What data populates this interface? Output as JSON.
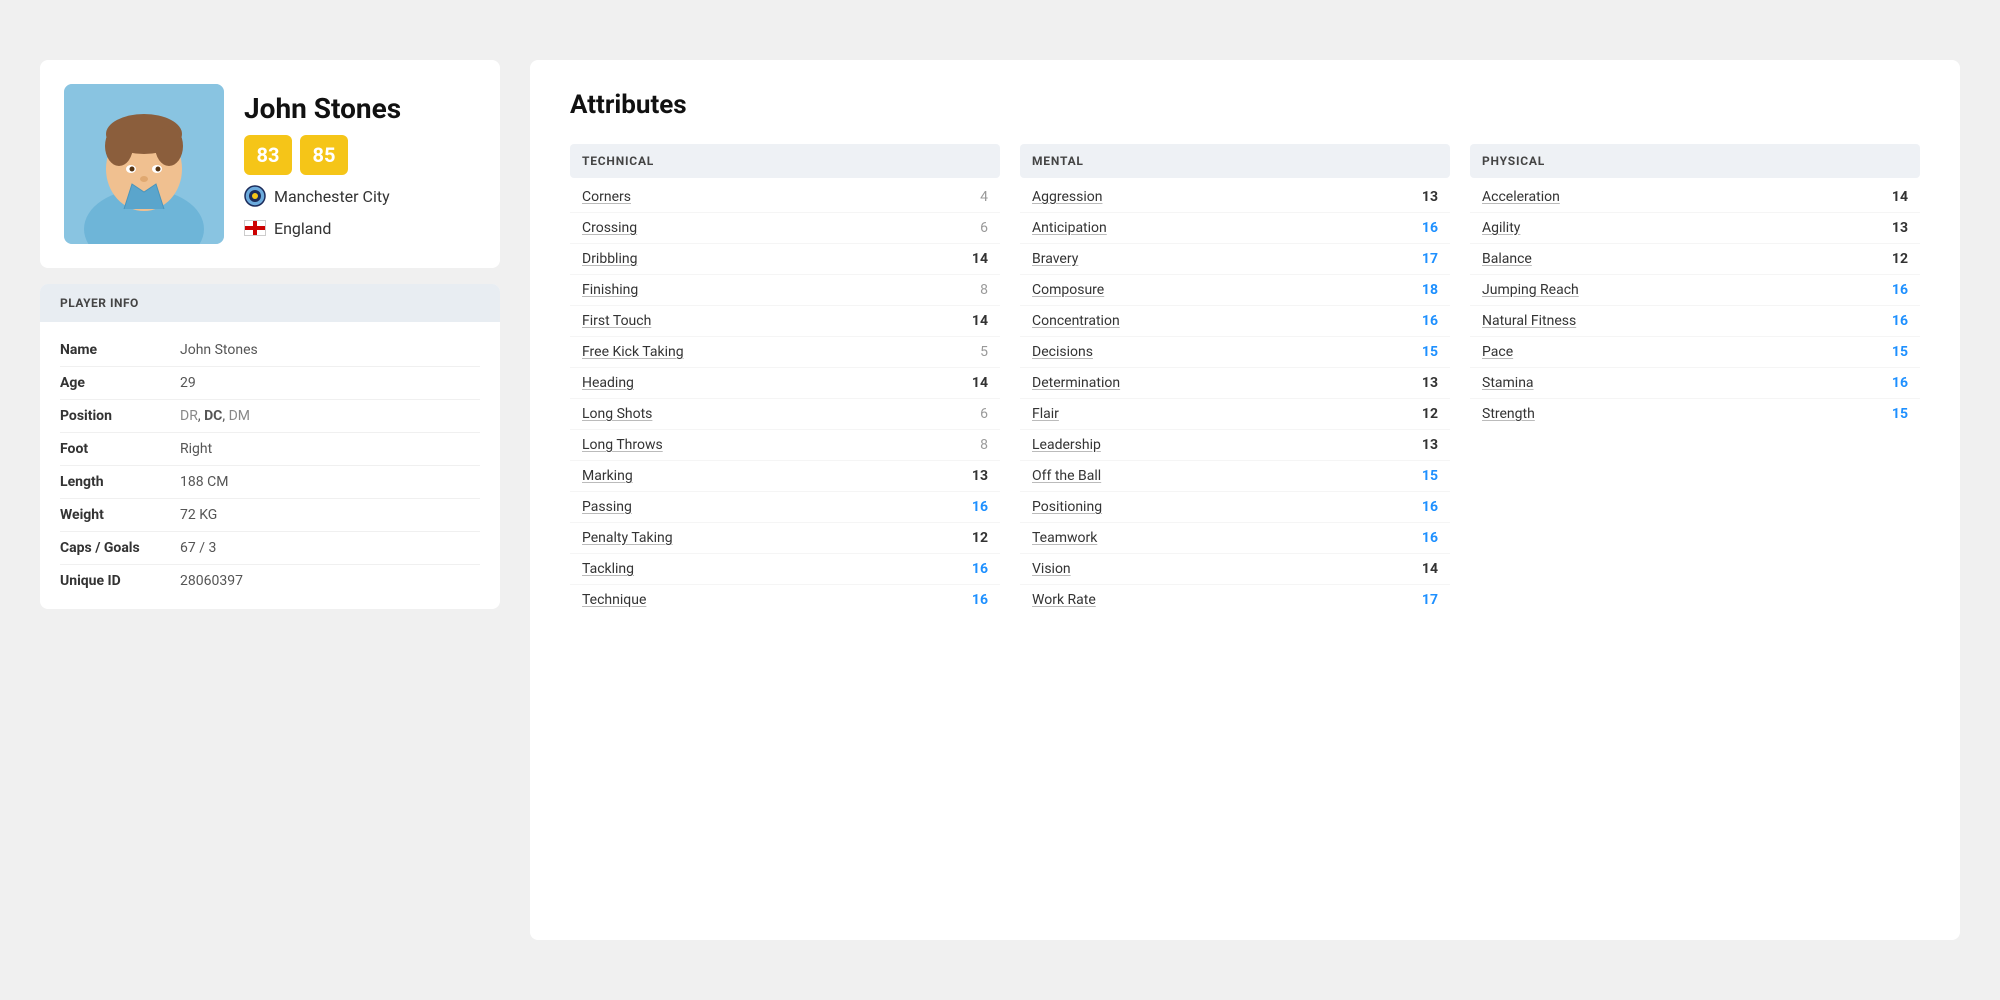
{
  "player": {
    "name": "John Stones",
    "rating1": "83",
    "rating2": "85",
    "club": "Manchester City",
    "nation": "England",
    "info": {
      "header": "PLAYER INFO",
      "rows": [
        {
          "label": "Name",
          "value": "John Stones",
          "positions": null
        },
        {
          "label": "Age",
          "value": "29",
          "positions": null
        },
        {
          "label": "Position",
          "value": null,
          "positions": [
            {
              "text": "DR",
              "bold": false
            },
            {
              "text": "DC",
              "bold": true
            },
            {
              "text": "DM",
              "bold": false
            }
          ]
        },
        {
          "label": "Foot",
          "value": "Right",
          "positions": null
        },
        {
          "label": "Length",
          "value": "188 CM",
          "positions": null
        },
        {
          "label": "Weight",
          "value": "72 KG",
          "positions": null
        },
        {
          "label": "Caps / Goals",
          "value": "67 / 3",
          "positions": null
        },
        {
          "label": "Unique ID",
          "value": "28060397",
          "positions": null
        }
      ]
    }
  },
  "attributes": {
    "title": "Attributes",
    "technical": {
      "header": "TECHNICAL",
      "items": [
        {
          "name": "Corners",
          "value": "4",
          "style": "low"
        },
        {
          "name": "Crossing",
          "value": "6",
          "style": "low"
        },
        {
          "name": "Dribbling",
          "value": "14",
          "style": "normal"
        },
        {
          "name": "Finishing",
          "value": "8",
          "style": "low"
        },
        {
          "name": "First Touch",
          "value": "14",
          "style": "normal"
        },
        {
          "name": "Free Kick Taking",
          "value": "5",
          "style": "low"
        },
        {
          "name": "Heading",
          "value": "14",
          "style": "normal"
        },
        {
          "name": "Long Shots",
          "value": "6",
          "style": "low"
        },
        {
          "name": "Long Throws",
          "value": "8",
          "style": "low"
        },
        {
          "name": "Marking",
          "value": "13",
          "style": "normal"
        },
        {
          "name": "Passing",
          "value": "16",
          "style": "highlight"
        },
        {
          "name": "Penalty Taking",
          "value": "12",
          "style": "normal"
        },
        {
          "name": "Tackling",
          "value": "16",
          "style": "highlight"
        },
        {
          "name": "Technique",
          "value": "16",
          "style": "highlight"
        }
      ]
    },
    "mental": {
      "header": "MENTAL",
      "items": [
        {
          "name": "Aggression",
          "value": "13",
          "style": "normal"
        },
        {
          "name": "Anticipation",
          "value": "16",
          "style": "highlight"
        },
        {
          "name": "Bravery",
          "value": "17",
          "style": "highlight"
        },
        {
          "name": "Composure",
          "value": "18",
          "style": "highlight"
        },
        {
          "name": "Concentration",
          "value": "16",
          "style": "highlight"
        },
        {
          "name": "Decisions",
          "value": "15",
          "style": "highlight"
        },
        {
          "name": "Determination",
          "value": "13",
          "style": "normal"
        },
        {
          "name": "Flair",
          "value": "12",
          "style": "normal"
        },
        {
          "name": "Leadership",
          "value": "13",
          "style": "normal"
        },
        {
          "name": "Off the Ball",
          "value": "15",
          "style": "highlight"
        },
        {
          "name": "Positioning",
          "value": "16",
          "style": "highlight"
        },
        {
          "name": "Teamwork",
          "value": "16",
          "style": "highlight"
        },
        {
          "name": "Vision",
          "value": "14",
          "style": "normal"
        },
        {
          "name": "Work Rate",
          "value": "17",
          "style": "highlight"
        }
      ]
    },
    "physical": {
      "header": "PHYSICAL",
      "items": [
        {
          "name": "Acceleration",
          "value": "14",
          "style": "normal"
        },
        {
          "name": "Agility",
          "value": "13",
          "style": "normal"
        },
        {
          "name": "Balance",
          "value": "12",
          "style": "normal"
        },
        {
          "name": "Jumping Reach",
          "value": "16",
          "style": "highlight"
        },
        {
          "name": "Natural Fitness",
          "value": "16",
          "style": "highlight"
        },
        {
          "name": "Pace",
          "value": "15",
          "style": "highlight"
        },
        {
          "name": "Stamina",
          "value": "16",
          "style": "highlight"
        },
        {
          "name": "Strength",
          "value": "15",
          "style": "highlight"
        }
      ]
    }
  }
}
